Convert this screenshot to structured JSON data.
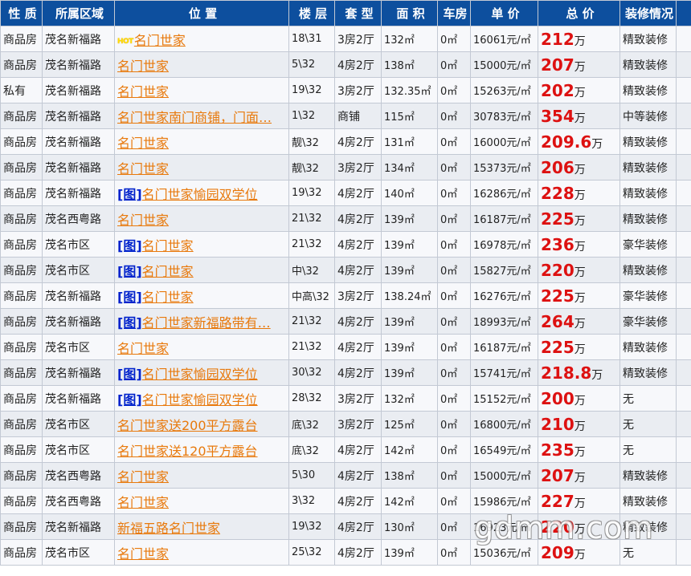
{
  "headers": [
    "性 质",
    "所属区域",
    "位 置",
    "楼 层",
    "套 型",
    "面 积",
    "车房",
    "单 价",
    "总 价",
    "装修情况"
  ],
  "hot_text": "HOT",
  "wan_unit": "万",
  "rows": [
    {
      "nature": "商品房",
      "area": "茂名新福路",
      "hot": true,
      "pic": false,
      "title": "名门世家",
      "floor": "18\\31",
      "layout": "3房2厅",
      "size": "132㎡",
      "garage": "0㎡",
      "unit_price": "16061元/㎡",
      "total": "212",
      "decor": "精致装修"
    },
    {
      "nature": "商品房",
      "area": "茂名新福路",
      "hot": false,
      "pic": false,
      "title": "名门世家",
      "floor": "5\\32",
      "layout": "4房2厅",
      "size": "138㎡",
      "garage": "0㎡",
      "unit_price": "15000元/㎡",
      "total": "207",
      "decor": "精致装修"
    },
    {
      "nature": "私有",
      "area": "茂名新福路",
      "hot": false,
      "pic": false,
      "title": "名门世家",
      "floor": "19\\32",
      "layout": "3房2厅",
      "size": "132.35㎡",
      "garage": "0㎡",
      "unit_price": "15263元/㎡",
      "total": "202",
      "decor": "精致装修"
    },
    {
      "nature": "商品房",
      "area": "茂名新福路",
      "hot": false,
      "pic": false,
      "title": "名门世家南门商铺，门面…",
      "floor": "1\\32",
      "layout": "商铺",
      "size": "115㎡",
      "garage": "0㎡",
      "unit_price": "30783元/㎡",
      "total": "354",
      "decor": "中等装修"
    },
    {
      "nature": "商品房",
      "area": "茂名新福路",
      "hot": false,
      "pic": false,
      "title": "名门世家",
      "floor": "靓\\32",
      "layout": "4房2厅",
      "size": "131㎡",
      "garage": "0㎡",
      "unit_price": "16000元/㎡",
      "total": "209.6",
      "decor": "精致装修"
    },
    {
      "nature": "商品房",
      "area": "茂名新福路",
      "hot": false,
      "pic": false,
      "title": "名门世家",
      "floor": "靓\\32",
      "layout": "3房2厅",
      "size": "134㎡",
      "garage": "0㎡",
      "unit_price": "15373元/㎡",
      "total": "206",
      "decor": "精致装修"
    },
    {
      "nature": "商品房",
      "area": "茂名新福路",
      "hot": false,
      "pic": true,
      "title": "名门世家愉园双学位",
      "floor": "19\\32",
      "layout": "4房2厅",
      "size": "140㎡",
      "garage": "0㎡",
      "unit_price": "16286元/㎡",
      "total": "228",
      "decor": "精致装修"
    },
    {
      "nature": "商品房",
      "area": "茂名西粤路",
      "hot": false,
      "pic": false,
      "title": "名门世家",
      "floor": "21\\32",
      "layout": "4房2厅",
      "size": "139㎡",
      "garage": "0㎡",
      "unit_price": "16187元/㎡",
      "total": "225",
      "decor": "精致装修"
    },
    {
      "nature": "商品房",
      "area": "茂名市区",
      "hot": false,
      "pic": true,
      "title": "名门世家",
      "floor": "21\\32",
      "layout": "4房2厅",
      "size": "139㎡",
      "garage": "0㎡",
      "unit_price": "16978元/㎡",
      "total": "236",
      "decor": "豪华装修"
    },
    {
      "nature": "商品房",
      "area": "茂名市区",
      "hot": false,
      "pic": true,
      "title": "名门世家",
      "floor": "中\\32",
      "layout": "4房2厅",
      "size": "139㎡",
      "garage": "0㎡",
      "unit_price": "15827元/㎡",
      "total": "220",
      "decor": "精致装修"
    },
    {
      "nature": "商品房",
      "area": "茂名新福路",
      "hot": false,
      "pic": true,
      "title": "名门世家",
      "floor": "中高\\32",
      "layout": "3房2厅",
      "size": "138.24㎡",
      "garage": "0㎡",
      "unit_price": "16276元/㎡",
      "total": "225",
      "decor": "豪华装修"
    },
    {
      "nature": "商品房",
      "area": "茂名新福路",
      "hot": false,
      "pic": true,
      "title": "名门世家新福路带有…",
      "floor": "21\\32",
      "layout": "4房2厅",
      "size": "139㎡",
      "garage": "0㎡",
      "unit_price": "18993元/㎡",
      "total": "264",
      "decor": "豪华装修"
    },
    {
      "nature": "商品房",
      "area": "茂名市区",
      "hot": false,
      "pic": false,
      "title": "名门世家",
      "floor": "21\\32",
      "layout": "4房2厅",
      "size": "139㎡",
      "garage": "0㎡",
      "unit_price": "16187元/㎡",
      "total": "225",
      "decor": "精致装修"
    },
    {
      "nature": "商品房",
      "area": "茂名新福路",
      "hot": false,
      "pic": true,
      "title": "名门世家愉园双学位",
      "floor": "30\\32",
      "layout": "4房2厅",
      "size": "139㎡",
      "garage": "0㎡",
      "unit_price": "15741元/㎡",
      "total": "218.8",
      "decor": "精致装修"
    },
    {
      "nature": "商品房",
      "area": "茂名新福路",
      "hot": false,
      "pic": true,
      "title": "名门世家愉园双学位",
      "floor": "28\\32",
      "layout": "3房2厅",
      "size": "132㎡",
      "garage": "0㎡",
      "unit_price": "15152元/㎡",
      "total": "200",
      "decor": "无"
    },
    {
      "nature": "商品房",
      "area": "茂名市区",
      "hot": false,
      "pic": false,
      "title": "名门世家送200平方露台",
      "floor": "底\\32",
      "layout": "3房2厅",
      "size": "125㎡",
      "garage": "0㎡",
      "unit_price": "16800元/㎡",
      "total": "210",
      "decor": "无"
    },
    {
      "nature": "商品房",
      "area": "茂名市区",
      "hot": false,
      "pic": false,
      "title": "名门世家送120平方露台",
      "floor": "底\\32",
      "layout": "4房2厅",
      "size": "142㎡",
      "garage": "0㎡",
      "unit_price": "16549元/㎡",
      "total": "235",
      "decor": "无"
    },
    {
      "nature": "商品房",
      "area": "茂名西粤路",
      "hot": false,
      "pic": false,
      "title": "名门世家",
      "floor": "5\\30",
      "layout": "4房2厅",
      "size": "138㎡",
      "garage": "0㎡",
      "unit_price": "15000元/㎡",
      "total": "207",
      "decor": "精致装修"
    },
    {
      "nature": "商品房",
      "area": "茂名西粤路",
      "hot": false,
      "pic": false,
      "title": "名门世家",
      "floor": "3\\32",
      "layout": "4房2厅",
      "size": "142㎡",
      "garage": "0㎡",
      "unit_price": "15986元/㎡",
      "total": "227",
      "decor": "精致装修"
    },
    {
      "nature": "商品房",
      "area": "茂名新福路",
      "hot": false,
      "pic": false,
      "title": "新福五路名门世家",
      "floor": "19\\32",
      "layout": "4房2厅",
      "size": "130㎡",
      "garage": "0㎡",
      "unit_price": "16923元/㎡",
      "total": "220",
      "decor": "精致装修"
    },
    {
      "nature": "商品房",
      "area": "茂名市区",
      "hot": false,
      "pic": false,
      "title": "名门世家",
      "floor": "25\\32",
      "layout": "4房2厅",
      "size": "139㎡",
      "garage": "0㎡",
      "unit_price": "15036元/㎡",
      "total": "209",
      "decor": "无"
    }
  ],
  "pic_label": "[图]",
  "watermark": "gdmm.com"
}
